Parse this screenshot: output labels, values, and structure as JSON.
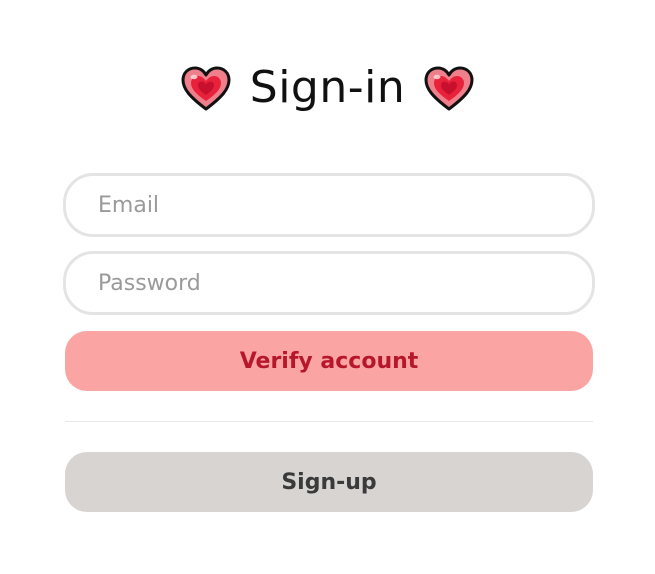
{
  "header": {
    "title": "Sign-in",
    "left_icon": "heart-icon",
    "right_icon": "heart-icon"
  },
  "form": {
    "email": {
      "placeholder": "Email",
      "value": ""
    },
    "password": {
      "placeholder": "Password",
      "value": ""
    },
    "verify_label": "Verify account",
    "signup_label": "Sign-up"
  },
  "colors": {
    "heart_outer": "#f07f8c",
    "heart_inner": "#e8223a",
    "verify_bg": "#fba4a4",
    "verify_text": "#b7172a",
    "signup_bg": "#d8d4d2",
    "field_border": "#e4e4e4"
  }
}
